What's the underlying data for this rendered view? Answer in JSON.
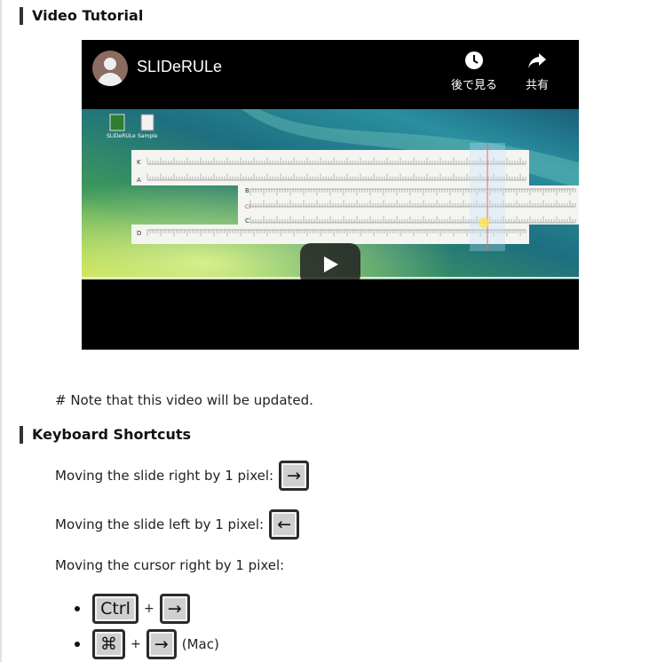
{
  "sections": {
    "video_title": "Video Tutorial",
    "keys_title": "Keyboard Shortcuts"
  },
  "player": {
    "channel_name": "SLIDeRULe",
    "watch_later_label": "後で見る",
    "share_label": "共有",
    "icons": [
      "avatar-icon",
      "clock-icon",
      "share-icon",
      "play-icon"
    ],
    "desktop_icons": [
      "SLIDeRULe",
      "Sample"
    ],
    "scale_labels": [
      "K",
      "A",
      "B",
      "CI",
      "C",
      "D"
    ]
  },
  "note": "# Note that this video will be updated.",
  "shortcuts": {
    "slide_right": {
      "label": "Moving the slide right by 1 pixel:",
      "key": "→"
    },
    "slide_left": {
      "label": "Moving the slide left by 1 pixel:",
      "key": "←"
    },
    "cursor_right": {
      "label": "Moving the cursor right by 1 pixel:"
    },
    "combos": [
      {
        "modifier": "Ctrl",
        "plus": "+",
        "key": "→",
        "suffix": ""
      },
      {
        "modifier": "⌘",
        "plus": "+",
        "key": "→",
        "suffix": "(Mac)"
      }
    ]
  }
}
